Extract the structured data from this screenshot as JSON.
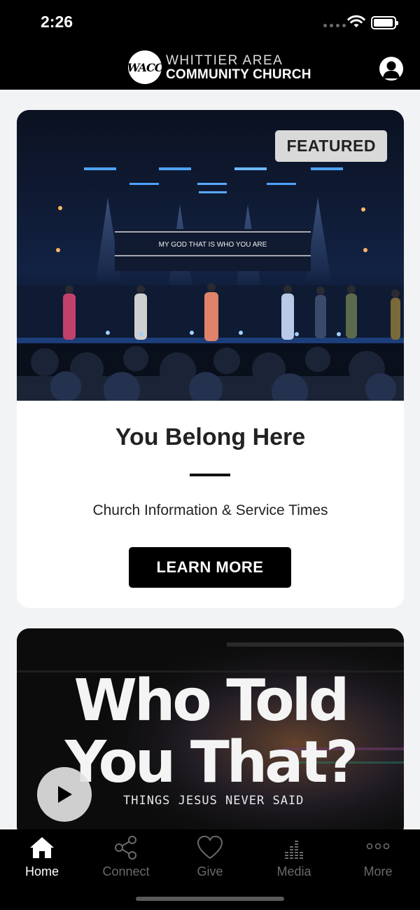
{
  "status_bar": {
    "time": "2:26"
  },
  "header": {
    "logo_mark": "WACC",
    "logo_line1": "WHITTIER AREA",
    "logo_line2": "COMMUNITY CHURCH",
    "profile_icon": "person-circle-icon"
  },
  "featured_card": {
    "badge": "FEATURED",
    "screen_text": "MY GOD THAT IS WHO YOU ARE",
    "title": "You Belong Here",
    "subtitle": "Church Information & Service Times",
    "button_label": "LEARN MORE"
  },
  "sermon_card": {
    "title_line1": "Who Told",
    "title_line2": "You That?",
    "subtitle": "THINGS JESUS NEVER SAID",
    "play_icon": "play-icon"
  },
  "tab_bar": {
    "items": [
      {
        "label": "Home",
        "icon": "home-icon",
        "active": true
      },
      {
        "label": "Connect",
        "icon": "share-icon",
        "active": false
      },
      {
        "label": "Give",
        "icon": "heart-icon",
        "active": false
      },
      {
        "label": "Media",
        "icon": "equalizer-icon",
        "active": false
      },
      {
        "label": "More",
        "icon": "more-dots-icon",
        "active": false
      }
    ]
  },
  "colors": {
    "header_bg": "#000000",
    "page_bg": "#f2f3f5",
    "button_bg": "#000000",
    "badge_bg": "#d9d9d9",
    "tab_inactive": "#6a6a6a"
  }
}
